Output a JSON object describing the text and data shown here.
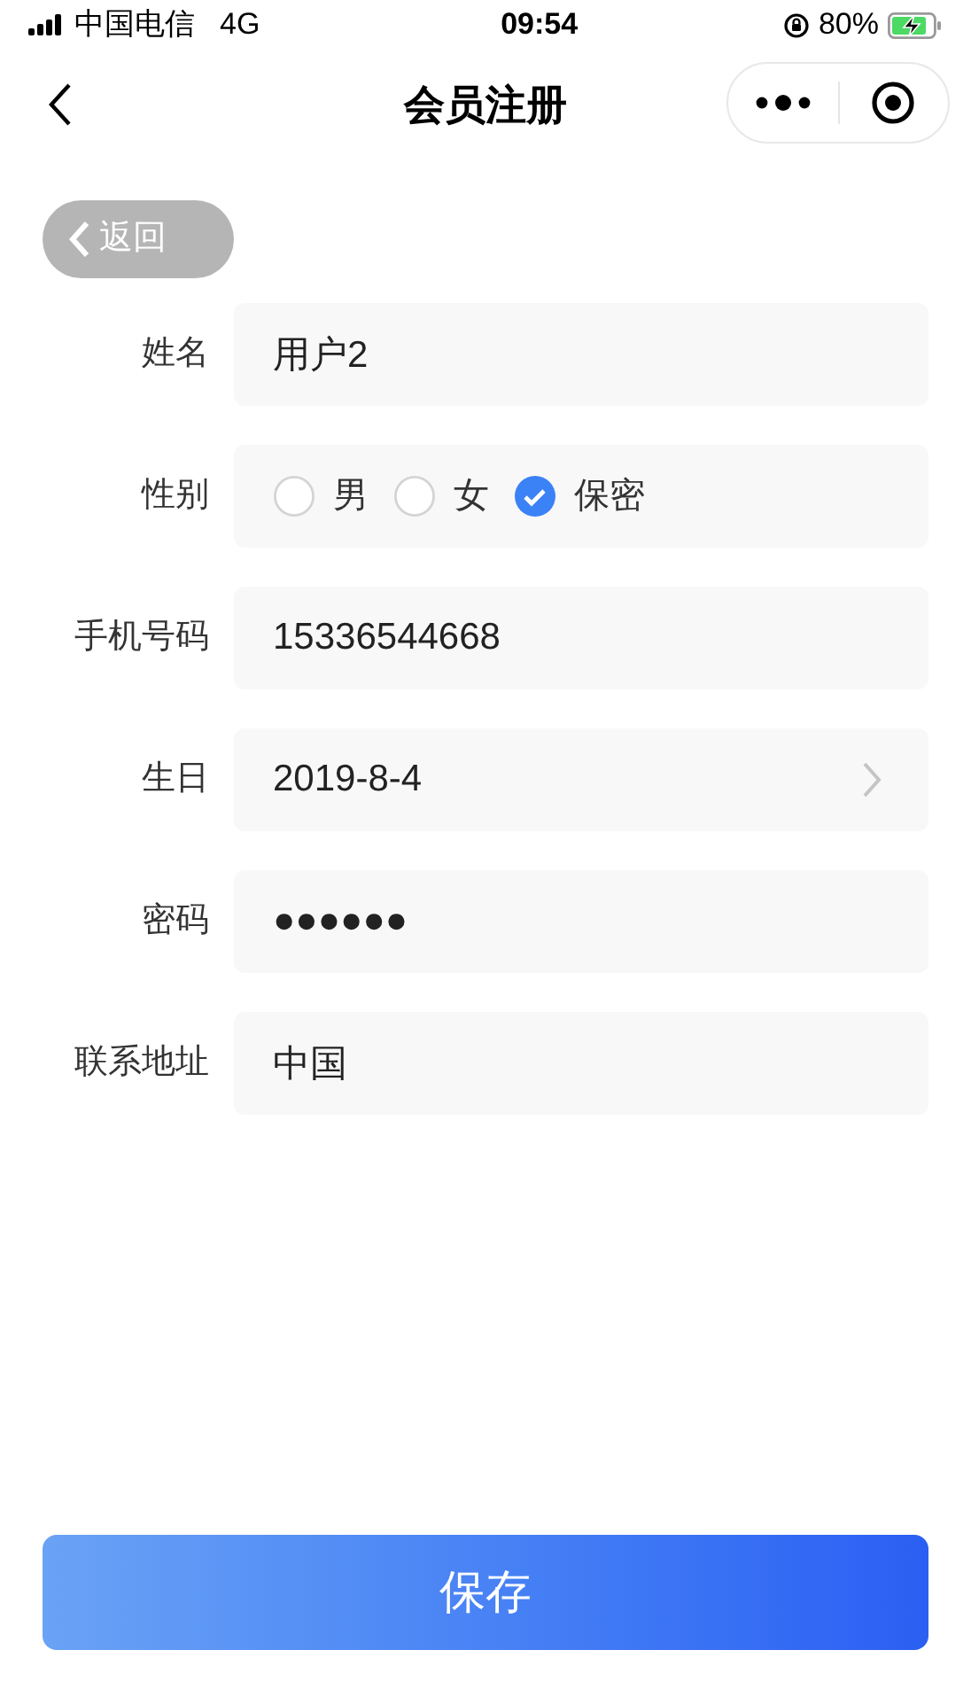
{
  "status_bar": {
    "carrier": "中国电信",
    "network": "4G",
    "time": "09:54",
    "battery": "80%"
  },
  "nav_bar": {
    "title": "会员注册"
  },
  "back_button": {
    "label": "返回"
  },
  "form": [
    {
      "kind": "text",
      "label": "姓名",
      "value": "用户2"
    },
    {
      "kind": "radio",
      "label": "性别",
      "options": [
        {
          "label": "男",
          "selected": false
        },
        {
          "label": "女",
          "selected": false
        },
        {
          "label": "保密",
          "selected": true
        }
      ]
    },
    {
      "kind": "text",
      "label": "手机号码",
      "value": "15336544668"
    },
    {
      "kind": "select",
      "label": "生日",
      "value": "2019-8-4"
    },
    {
      "kind": "password",
      "label": "密码",
      "value": "●●●●●●"
    },
    {
      "kind": "text",
      "label": "联系地址",
      "value": "中国"
    }
  ],
  "save_button": {
    "label": "保存"
  }
}
